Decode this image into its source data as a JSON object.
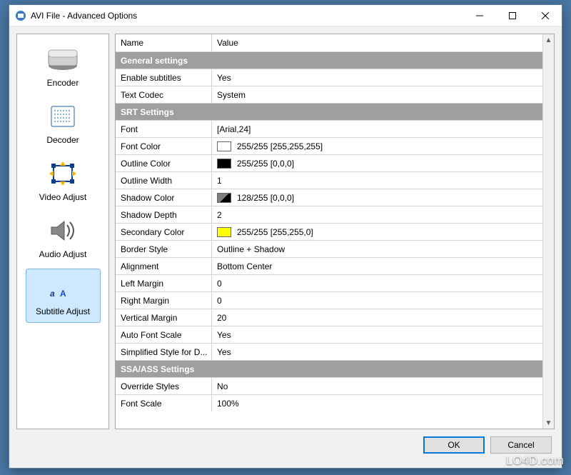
{
  "window": {
    "title": "AVI File - Advanced Options"
  },
  "sidebar": {
    "items": [
      {
        "label": "Encoder"
      },
      {
        "label": "Decoder"
      },
      {
        "label": "Video Adjust"
      },
      {
        "label": "Audio Adjust"
      },
      {
        "label": "Subtitle Adjust"
      }
    ]
  },
  "grid": {
    "header": {
      "name": "Name",
      "value": "Value"
    },
    "sections": [
      {
        "title": "General settings",
        "rows": [
          {
            "name": "Enable subtitles",
            "value": "Yes"
          },
          {
            "name": "Text Codec",
            "value": "System"
          }
        ]
      },
      {
        "title": "SRT Settings",
        "rows": [
          {
            "name": "Font",
            "value": "[Arial,24]"
          },
          {
            "name": "Font Color",
            "value": "255/255 [255,255,255]",
            "swatch": "#ffffff"
          },
          {
            "name": "Outline Color",
            "value": "255/255 [0,0,0]",
            "swatch": "#000000"
          },
          {
            "name": "Outline Width",
            "value": "1"
          },
          {
            "name": "Shadow Color",
            "value": "128/255 [0,0,0]",
            "swatch": "split"
          },
          {
            "name": "Shadow Depth",
            "value": "2"
          },
          {
            "name": "Secondary Color",
            "value": "255/255 [255,255,0]",
            "swatch": "#ffff00"
          },
          {
            "name": "Border Style",
            "value": "Outline + Shadow"
          },
          {
            "name": "Alignment",
            "value": "Bottom Center"
          },
          {
            "name": "Left Margin",
            "value": "0"
          },
          {
            "name": "Right Margin",
            "value": "0"
          },
          {
            "name": "Vertical Margin",
            "value": "20"
          },
          {
            "name": "Auto Font Scale",
            "value": "Yes"
          },
          {
            "name": "Simplified Style for D...",
            "value": "Yes"
          }
        ]
      },
      {
        "title": "SSA/ASS Settings",
        "rows": [
          {
            "name": "Override Styles",
            "value": "No"
          },
          {
            "name": "Font Scale",
            "value": "100%"
          }
        ]
      }
    ]
  },
  "buttons": {
    "ok": "OK",
    "cancel": "Cancel"
  },
  "watermark": "LO4D.com"
}
